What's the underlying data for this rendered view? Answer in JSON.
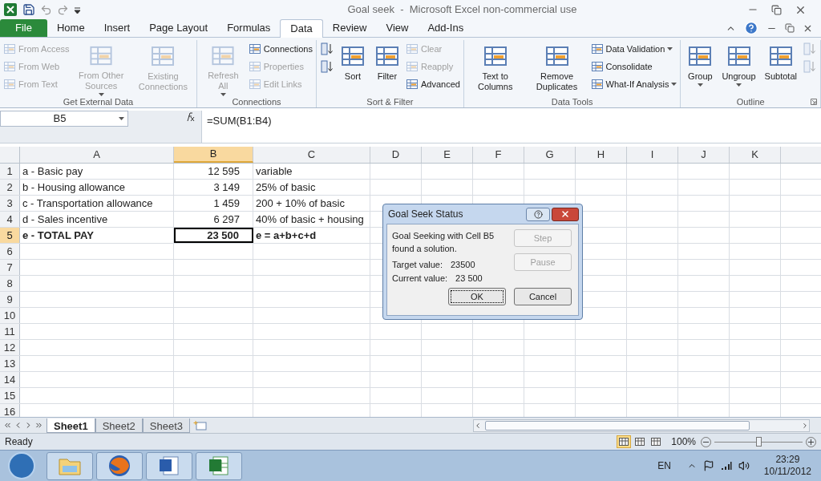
{
  "window": {
    "title": "Goal seek  -  Microsoft Excel non-commercial use"
  },
  "ribbon_tabs": [
    {
      "label": "File",
      "kind": "file",
      "selected": false
    },
    {
      "label": "Home",
      "kind": "tab",
      "selected": false
    },
    {
      "label": "Insert",
      "kind": "tab",
      "selected": false
    },
    {
      "label": "Page Layout",
      "kind": "tab",
      "selected": false
    },
    {
      "label": "Formulas",
      "kind": "tab",
      "selected": false
    },
    {
      "label": "Data",
      "kind": "tab",
      "selected": true
    },
    {
      "label": "Review",
      "kind": "tab",
      "selected": false
    },
    {
      "label": "View",
      "kind": "tab",
      "selected": false
    },
    {
      "label": "Add-Ins",
      "kind": "tab",
      "selected": false
    }
  ],
  "ribbon": {
    "groups": [
      {
        "title": "Get External Data",
        "items": [
          {
            "kind": "small",
            "label": "From Access",
            "disabled": true
          },
          {
            "kind": "small",
            "label": "From Web",
            "disabled": true
          },
          {
            "kind": "small",
            "label": "From Text",
            "disabled": true
          },
          {
            "kind": "large",
            "label": "From Other Sources",
            "disabled": true,
            "dropdown": true
          },
          {
            "kind": "large",
            "label": "Existing Connections",
            "disabled": true
          }
        ]
      },
      {
        "title": "Connections",
        "items": [
          {
            "kind": "large",
            "label": "Refresh All",
            "disabled": true,
            "dropdown": true
          },
          {
            "kind": "small",
            "label": "Connections",
            "disabled": false
          },
          {
            "kind": "small",
            "label": "Properties",
            "disabled": true
          },
          {
            "kind": "small",
            "label": "Edit Links",
            "disabled": true
          }
        ]
      },
      {
        "title": "Sort & Filter",
        "items": [
          {
            "kind": "icon",
            "disabled": false
          },
          {
            "kind": "icon",
            "disabled": false
          },
          {
            "kind": "large",
            "label": "Sort",
            "disabled": false
          },
          {
            "kind": "large",
            "label": "Filter",
            "disabled": false
          },
          {
            "kind": "small",
            "label": "Clear",
            "disabled": true
          },
          {
            "kind": "small",
            "label": "Reapply",
            "disabled": true
          },
          {
            "kind": "small",
            "label": "Advanced",
            "disabled": false
          }
        ]
      },
      {
        "title": "Data Tools",
        "items": [
          {
            "kind": "large",
            "label": "Text to Columns",
            "disabled": false
          },
          {
            "kind": "large",
            "label": "Remove Duplicates",
            "disabled": false
          },
          {
            "kind": "small",
            "label": "Data Validation",
            "disabled": false,
            "dropdown": true
          },
          {
            "kind": "small",
            "label": "Consolidate",
            "disabled": false
          },
          {
            "kind": "small",
            "label": "What-If Analysis",
            "disabled": false,
            "dropdown": true
          }
        ]
      },
      {
        "title": "Outline",
        "launcher": true,
        "items": [
          {
            "kind": "large",
            "label": "Group",
            "disabled": false,
            "dropdown": true
          },
          {
            "kind": "large",
            "label": "Ungroup",
            "disabled": false,
            "dropdown": true
          },
          {
            "kind": "large",
            "label": "Subtotal",
            "disabled": false
          },
          {
            "kind": "icon",
            "disabled": true
          },
          {
            "kind": "icon",
            "disabled": true
          }
        ]
      }
    ]
  },
  "formula_bar": {
    "name_box": "B5",
    "formula": "=SUM(B1:B4)"
  },
  "sheet": {
    "columns": [
      {
        "label": "A",
        "selected": false
      },
      {
        "label": "B",
        "selected": true
      },
      {
        "label": "C",
        "selected": false
      },
      {
        "label": "D",
        "selected": false
      },
      {
        "label": "E",
        "selected": false
      },
      {
        "label": "F",
        "selected": false
      },
      {
        "label": "G",
        "selected": false
      },
      {
        "label": "H",
        "selected": false
      },
      {
        "label": "I",
        "selected": false
      },
      {
        "label": "J",
        "selected": false
      },
      {
        "label": "K",
        "selected": false
      }
    ],
    "rows": [
      {
        "number": "1",
        "selected": false,
        "cells": [
          {
            "text": "a - Basic pay",
            "active": false,
            "bold": false
          },
          {
            "text": "12 595",
            "active": false,
            "bold": false
          },
          {
            "text": "variable",
            "active": false,
            "bold": false
          }
        ]
      },
      {
        "number": "2",
        "selected": false,
        "cells": [
          {
            "text": "b - Housing allowance",
            "active": false,
            "bold": false
          },
          {
            "text": "3 149",
            "active": false,
            "bold": false
          },
          {
            "text": "25% of basic",
            "active": false,
            "bold": false
          }
        ]
      },
      {
        "number": "3",
        "selected": false,
        "cells": [
          {
            "text": "c - Transportation allowance",
            "active": false,
            "bold": false
          },
          {
            "text": "1 459",
            "active": false,
            "bold": false
          },
          {
            "text": "200 + 10% of basic",
            "active": false,
            "bold": false
          }
        ]
      },
      {
        "number": "4",
        "selected": false,
        "cells": [
          {
            "text": "d - Sales incentive",
            "active": false,
            "bold": false
          },
          {
            "text": "6 297",
            "active": false,
            "bold": false
          },
          {
            "text": "40% of basic + housing",
            "active": false,
            "bold": false
          }
        ]
      },
      {
        "number": "5",
        "selected": true,
        "cells": [
          {
            "text": "e - TOTAL PAY",
            "active": false,
            "bold": true
          },
          {
            "text": "23 500",
            "active": true,
            "bold": true
          },
          {
            "text": "e = a+b+c+d",
            "active": false,
            "bold": true
          }
        ]
      },
      {
        "number": "6",
        "selected": false
      },
      {
        "number": "7",
        "selected": false
      },
      {
        "number": "8",
        "selected": false
      },
      {
        "number": "9",
        "selected": false
      },
      {
        "number": "10",
        "selected": false
      },
      {
        "number": "11",
        "selected": false
      },
      {
        "number": "12",
        "selected": false
      },
      {
        "number": "13",
        "selected": false
      },
      {
        "number": "14",
        "selected": false
      },
      {
        "number": "15",
        "selected": false
      },
      {
        "number": "16",
        "selected": false
      }
    ]
  },
  "dialog": {
    "title": "Goal Seek Status",
    "message": "Goal Seeking with Cell B5 found a solution.",
    "target_label": "Target value:",
    "target_value": "23500",
    "current_label": "Current value:",
    "current_value": "23 500",
    "buttons": [
      {
        "label": "Step",
        "disabled": true,
        "default": false
      },
      {
        "label": "Pause",
        "disabled": true,
        "default": false
      },
      {
        "label": "OK",
        "disabled": false,
        "default": true
      },
      {
        "label": "Cancel",
        "disabled": false,
        "default": false
      }
    ]
  },
  "sheet_tabs": [
    {
      "label": "Sheet1",
      "selected": true
    },
    {
      "label": "Sheet2",
      "selected": false
    },
    {
      "label": "Sheet3",
      "selected": false
    }
  ],
  "status_bar": {
    "status": "Ready",
    "views": [
      {
        "selected": true
      },
      {
        "selected": false
      },
      {
        "selected": false
      }
    ],
    "zoom": "100%",
    "zoom_slider": {
      "level": 0.5
    }
  },
  "taskbar": {
    "apps": [
      {
        "kind": "folder"
      },
      {
        "kind": "browser"
      },
      {
        "kind": "document"
      },
      {
        "kind": "spreadsheet"
      }
    ],
    "language": "EN",
    "time": "23:29",
    "date": "10/11/2012"
  }
}
